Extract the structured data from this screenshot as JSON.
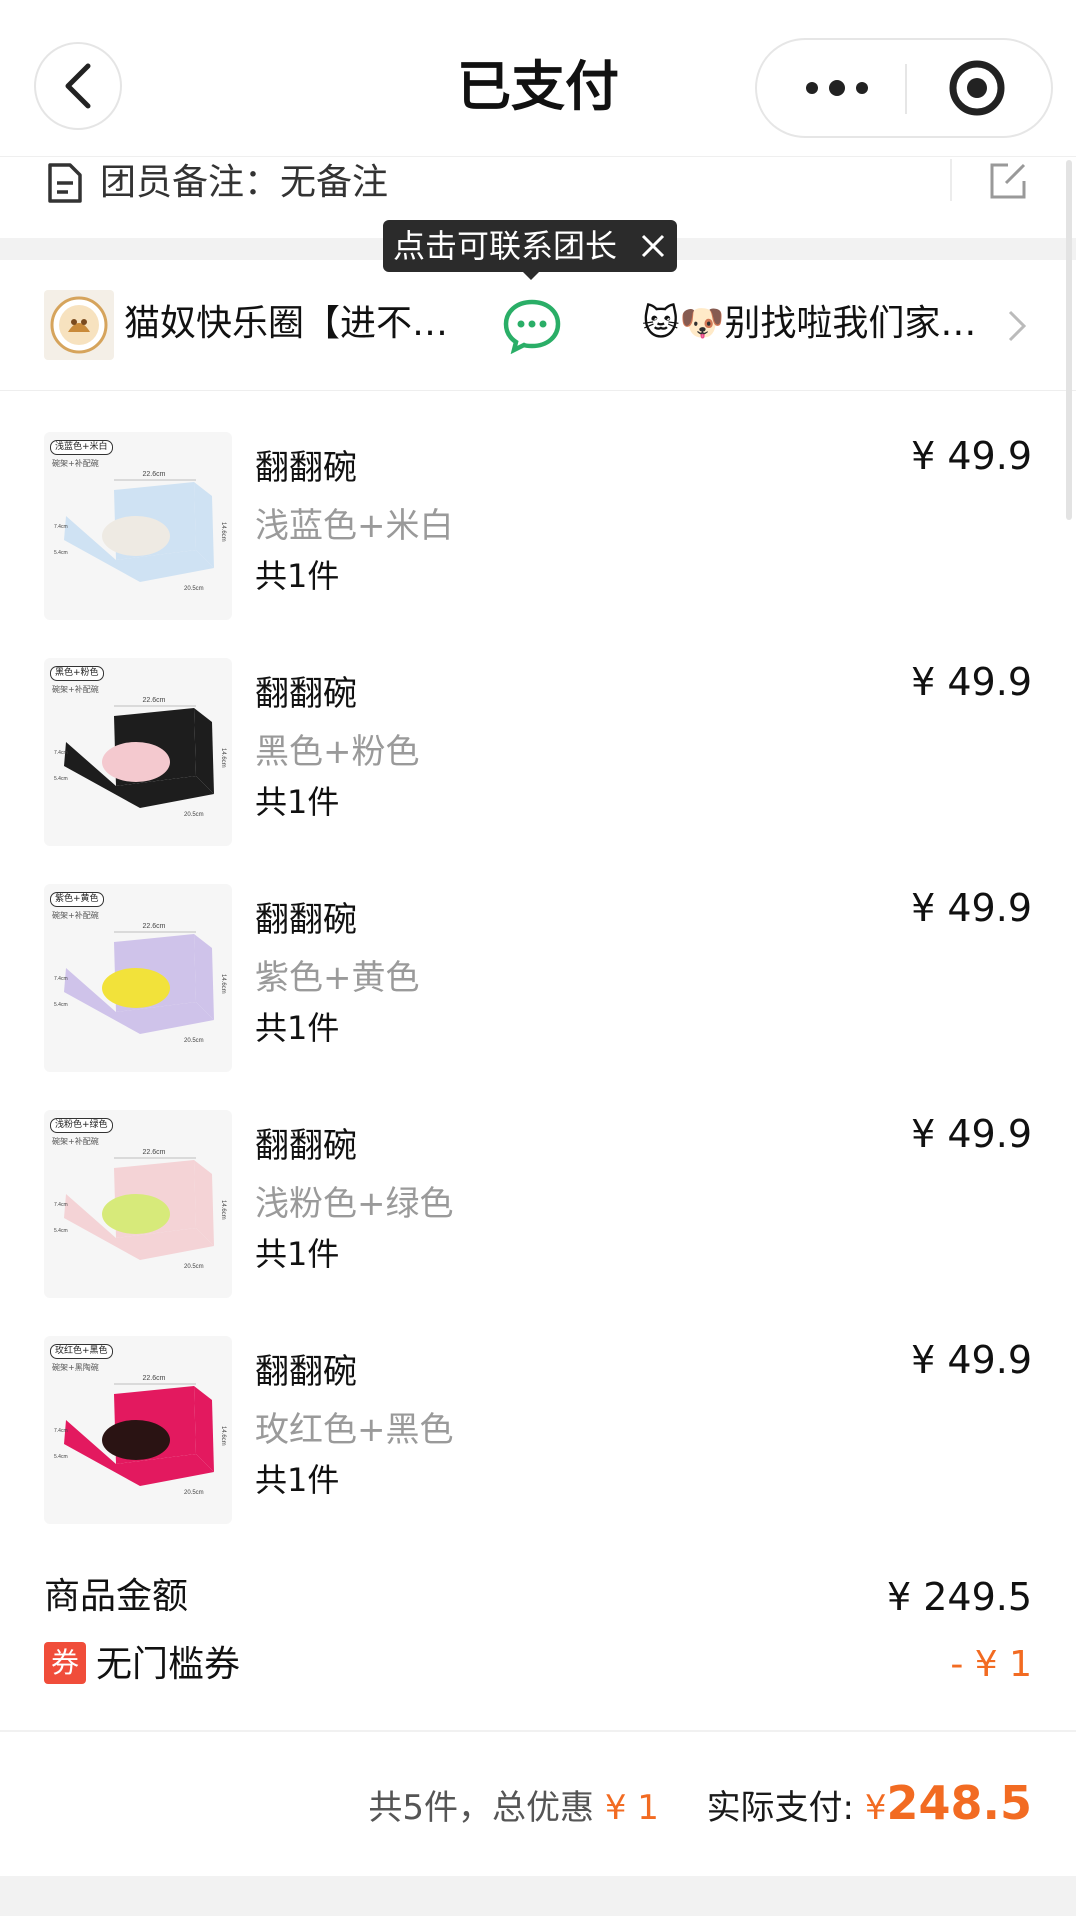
{
  "header": {
    "title": "已支付",
    "back_icon": "chevron-left-icon",
    "more_icon": "more-dots-icon",
    "target_icon": "target-icon"
  },
  "note": {
    "label": "团员备注：无备注",
    "icon": "document-icon",
    "edit_icon": "edit-icon"
  },
  "tooltip": {
    "text": "点击可联系团长",
    "close_icon": "close-icon"
  },
  "group": {
    "name": "猫奴快乐圈【进不…",
    "chat_icon": "wechat-chat-icon",
    "slogan": "🐱🐶别找啦我们家…",
    "chevron_icon": "chevron-right-icon"
  },
  "products": [
    {
      "name": "翻翻碗",
      "variant": "浅蓝色+米白",
      "qty": "共1件",
      "price": "¥ 49.9",
      "tag": "浅蓝色+米白",
      "tag_sub": "碗架+补配碗",
      "body_color": "#cfe2f3",
      "bowl_color": "#eeeae3"
    },
    {
      "name": "翻翻碗",
      "variant": "黑色+粉色",
      "qty": "共1件",
      "price": "¥ 49.9",
      "tag": "黑色+粉色",
      "tag_sub": "碗架+补配碗",
      "body_color": "#1d1d1d",
      "bowl_color": "#f4c9cf"
    },
    {
      "name": "翻翻碗",
      "variant": "紫色+黄色",
      "qty": "共1件",
      "price": "¥ 49.9",
      "tag": "紫色+黄色",
      "tag_sub": "碗架+补配碗",
      "body_color": "#cfc3ea",
      "bowl_color": "#f2e23a"
    },
    {
      "name": "翻翻碗",
      "variant": "浅粉色+绿色",
      "qty": "共1件",
      "price": "¥ 49.9",
      "tag": "浅粉色+绿色",
      "tag_sub": "碗架+补配碗",
      "body_color": "#f4d3d6",
      "bowl_color": "#d7ea7a"
    },
    {
      "name": "翻翻碗",
      "variant": "玫红色+黑色",
      "qty": "共1件",
      "price": "¥ 49.9",
      "tag": "玫红色+黑色",
      "tag_sub": "碗架+黑陶碗",
      "body_color": "#e3195f",
      "bowl_color": "#2a1313"
    }
  ],
  "summary": {
    "goods_label": "商品金额",
    "goods_value": "¥ 249.5",
    "coupon_badge": "券",
    "coupon_label": "无门槛券",
    "coupon_value": "- ¥ 1"
  },
  "total": {
    "count_text": "共5件，总优惠",
    "discount": "¥ 1",
    "pay_label": "实际支付:",
    "currency": "¥",
    "amount": "248.5"
  },
  "colors": {
    "accent_orange": "#f26b22",
    "coupon_red": "#f04d3a",
    "wechat_green": "#2aae67"
  }
}
